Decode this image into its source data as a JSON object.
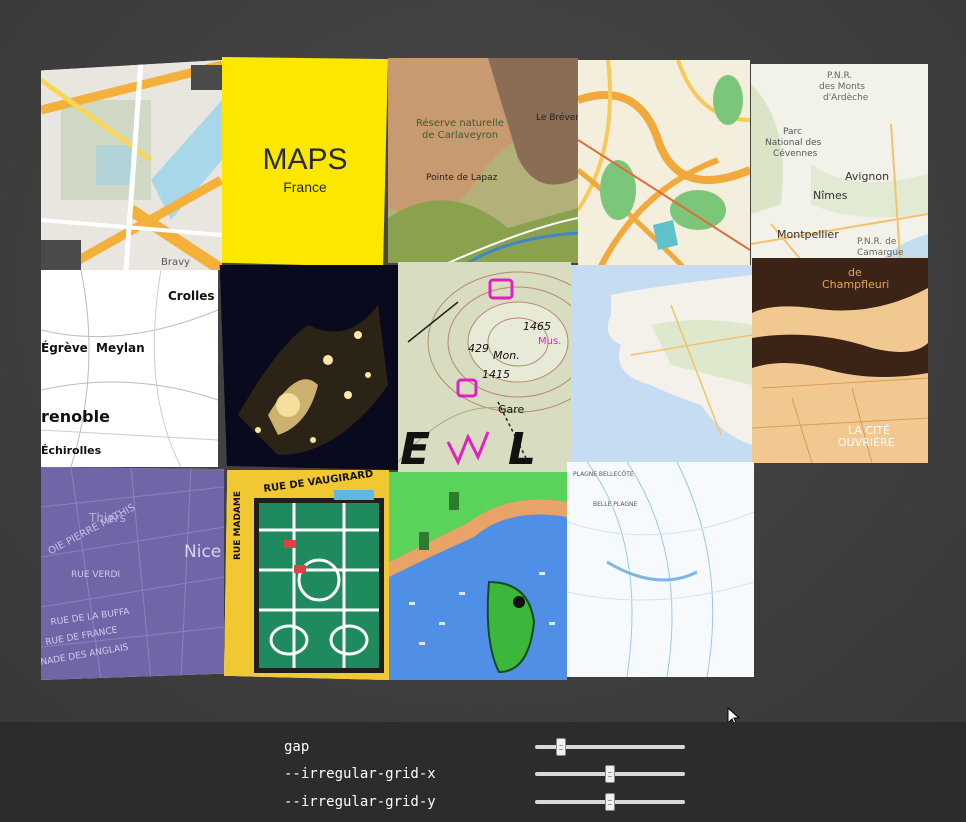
{
  "tiles": {
    "maps_title": "MAPS",
    "maps_subtitle": "France",
    "carlaveyron_1": "Réserve naturelle",
    "carlaveyron_2": "de Carlaveyron",
    "le_breve": "Le Brévent",
    "pointe": "Pointe de Lapaz",
    "pnr_1": "P.N.R.",
    "pnr_2": "des Monts",
    "pnr_3": "d'Ardèche",
    "parc_1": "Parc",
    "parc_2": "National des",
    "parc_3": "Cévennes",
    "avignon": "Avignon",
    "nimes": "Nîmes",
    "montpellier": "Montpellier",
    "camargue_1": "P.N.R. de",
    "camargue_2": "Camargue",
    "crolles": "Crolles",
    "egreve": "Égrève",
    "meylan": "Meylan",
    "grenoble": "renoble",
    "echirolles": "Échirolles",
    "topo_1465": "1465",
    "topo_1429": "429",
    "topo_1415": "1415",
    "topo_mon": "Mon.",
    "topo_mus": "Mus.",
    "topo_gare": "Gare",
    "topo_e": "E",
    "topo_l": "L",
    "champfleuri_1": "de",
    "champfleuri_2": "Champfleuri",
    "cite_1": "LA CITÉ",
    "cite_2": "OUVRIÈRE",
    "thiers": "Thiers",
    "nice": "Nice",
    "rue_verdi": "RUE VERDI",
    "rue_buffa": "RUE DE LA BUFFA",
    "rue_france": "RUE DE FRANCE",
    "anglais": "NADE DES ANGLAIS",
    "pierre_mathis": "OIE PIERRE MATHIS",
    "vaugirard": "RUE DE VAUGIRARD",
    "madame": "RUE MADAME",
    "plagne": "BELLE PLAGNE",
    "plagne_2": "PLAGNE BELLECÔTE",
    "gravy": "Bravy"
  },
  "controls": [
    {
      "label": "gap",
      "value": 0.17
    },
    {
      "label": "--irregular-grid-x",
      "value": 0.5
    },
    {
      "label": "--irregular-grid-y",
      "value": 0.5
    }
  ]
}
